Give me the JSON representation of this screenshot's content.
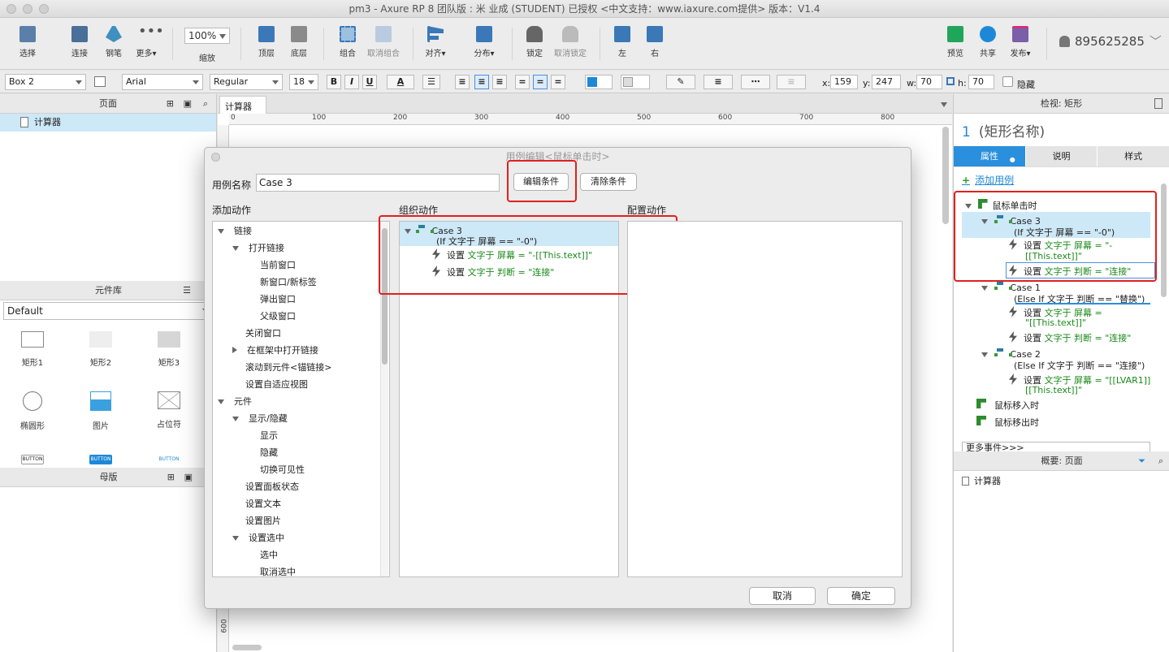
{
  "window": {
    "title": "pm3 - Axure RP 8 团队版 : 米 业成 (STUDENT) 已授权   <中文支持：www.iaxure.com提供> 版本：V1.4"
  },
  "toolbar": {
    "select": "选择",
    "connect": "连接",
    "pen": "钢笔",
    "more": "更多▾",
    "zoom_value": "100%",
    "zoom": "缩放",
    "top": "顶层",
    "bottom": "底层",
    "group": "组合",
    "ungroup": "取消组合",
    "align": "对齐▾",
    "distribute": "分布▾",
    "lock": "锁定",
    "unlock": "取消锁定",
    "left": "左",
    "right": "右",
    "preview": "预览",
    "share": "共享",
    "publish": "发布▾",
    "user": "895625285"
  },
  "format": {
    "style": "Box 2",
    "font": "Arial",
    "weight": "Regular",
    "size": "18",
    "x_label": "x:",
    "x": "159",
    "y_label": "y:",
    "y": "247",
    "w_label": "w:",
    "w": "70",
    "h_label": "h:",
    "h": "70",
    "hidden": "隐藏"
  },
  "pages": {
    "title": "页面",
    "item": "计算器"
  },
  "library": {
    "title": "元件库",
    "selected": "Default",
    "widgets": [
      "矩形1",
      "矩形2",
      "矩形3",
      "椭圆形",
      "图片",
      "占位符"
    ],
    "buttons": [
      "BUTTON",
      "BUTTON",
      "BUTTON"
    ]
  },
  "masters": {
    "title": "母版"
  },
  "canvas": {
    "tab": "计算器",
    "ruler_x": [
      "0",
      "100",
      "200",
      "300",
      "400",
      "500",
      "600",
      "700",
      "800"
    ],
    "ruler_y": "600"
  },
  "dialog": {
    "title": "用例编辑<鼠标单击时>",
    "case_name_label": "用例名称",
    "case_name": "Case 3",
    "edit_condition": "编辑条件",
    "clear_condition": "清除条件",
    "add_action": "添加动作",
    "organize": "组织动作",
    "configure": "配置动作",
    "cancel": "取消",
    "ok": "确定",
    "actions": [
      {
        "t": "链接",
        "lvl": 0,
        "exp": "down"
      },
      {
        "t": "打开链接",
        "lvl": 1,
        "exp": "down"
      },
      {
        "t": "当前窗口",
        "lvl": 2
      },
      {
        "t": "新窗口/新标签",
        "lvl": 2
      },
      {
        "t": "弹出窗口",
        "lvl": 2
      },
      {
        "t": "父级窗口",
        "lvl": 2
      },
      {
        "t": "关闭窗口",
        "lvl": 1
      },
      {
        "t": "在框架中打开链接",
        "lvl": 1,
        "exp": "right"
      },
      {
        "t": "滚动到元件<锚链接>",
        "lvl": 1
      },
      {
        "t": "设置自适应视图",
        "lvl": 1
      },
      {
        "t": "元件",
        "lvl": 0,
        "exp": "down"
      },
      {
        "t": "显示/隐藏",
        "lvl": 1,
        "exp": "down"
      },
      {
        "t": "显示",
        "lvl": 2
      },
      {
        "t": "隐藏",
        "lvl": 2
      },
      {
        "t": "切换可见性",
        "lvl": 2
      },
      {
        "t": "设置面板状态",
        "lvl": 1
      },
      {
        "t": "设置文本",
        "lvl": 1
      },
      {
        "t": "设置图片",
        "lvl": 1
      },
      {
        "t": "设置选中",
        "lvl": 1,
        "exp": "down"
      },
      {
        "t": "选中",
        "lvl": 2
      },
      {
        "t": "取消选中",
        "lvl": 2
      }
    ],
    "org_case": "Case 3",
    "org_cond": "(If 文字于 屏幕 == \"-0\")",
    "org_a1_pre": "设置",
    "org_a1": "文字于 屏幕 = \"-[[This.text]]\"",
    "org_a2_pre": "设置",
    "org_a2": "文字于 判断 = \"连接\""
  },
  "inspector": {
    "title": "检视: 矩形",
    "num": "1",
    "name": "(矩形名称)",
    "tabs": [
      "属性",
      "说明",
      "样式"
    ],
    "add_case": "添加用例",
    "event_click": "鼠标单击时",
    "case3": "Case 3",
    "case3_cond": "(If 文字于 屏幕 == \"-0\")",
    "c3a1_pre": "设置",
    "c3a1": "文字于 屏幕 = \"-",
    "c3a1b": "[[This.text]]\"",
    "c3a2_pre": "设置",
    "c3a2": "文字于 判断 = \"连接\"",
    "case1": "Case 1",
    "case1_cond": "(Else If 文字于 判断 == \"替换\")",
    "c1a1_pre": "设置",
    "c1a1": "文字于 屏幕 =",
    "c1a1b": "\"[[This.text]]\"",
    "c1a2_pre": "设置",
    "c1a2": "文字于 判断 = \"连接\"",
    "case2": "Case 2",
    "case2_cond": "(Else If 文字于 判断 == \"连接\")",
    "c2a1_pre": "设置",
    "c2a1": "文字于 屏幕 = \"[[LVAR1]]",
    "c2a1b": "[[This.text]]\"",
    "event_enter": "鼠标移入时",
    "event_leave": "鼠标移出时",
    "more_events": "更多事件>>>"
  },
  "outline": {
    "title": "概要: 页面",
    "item": "计算器"
  },
  "colors": {
    "accent": "#1e88d8",
    "tab_active": "#2a8fdc",
    "selection": "#cde8f7",
    "highlight_red": "#e02020",
    "action_green": "#1a8a1a"
  }
}
